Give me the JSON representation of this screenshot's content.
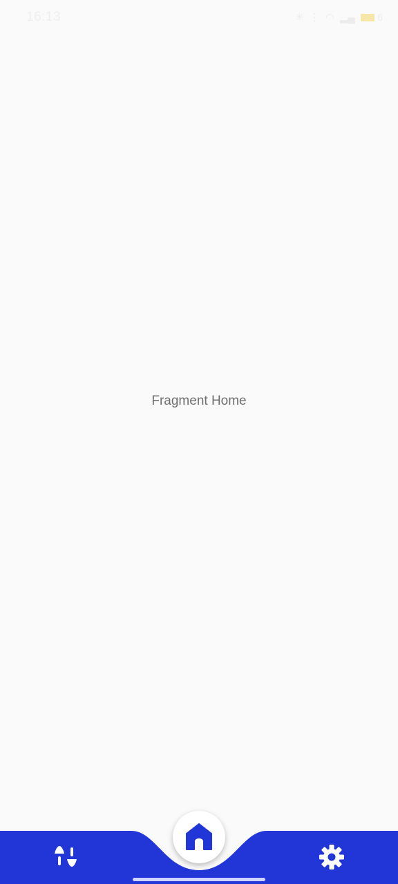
{
  "status_bar": {
    "time": "16:13",
    "battery_level": "6"
  },
  "main": {
    "text": "Fragment Home"
  },
  "bottom_nav": {
    "accent_color": "#2236d8",
    "left_icon": "sort-arrows-icon",
    "center_icon": "home-icon",
    "right_icon": "gear-icon"
  }
}
